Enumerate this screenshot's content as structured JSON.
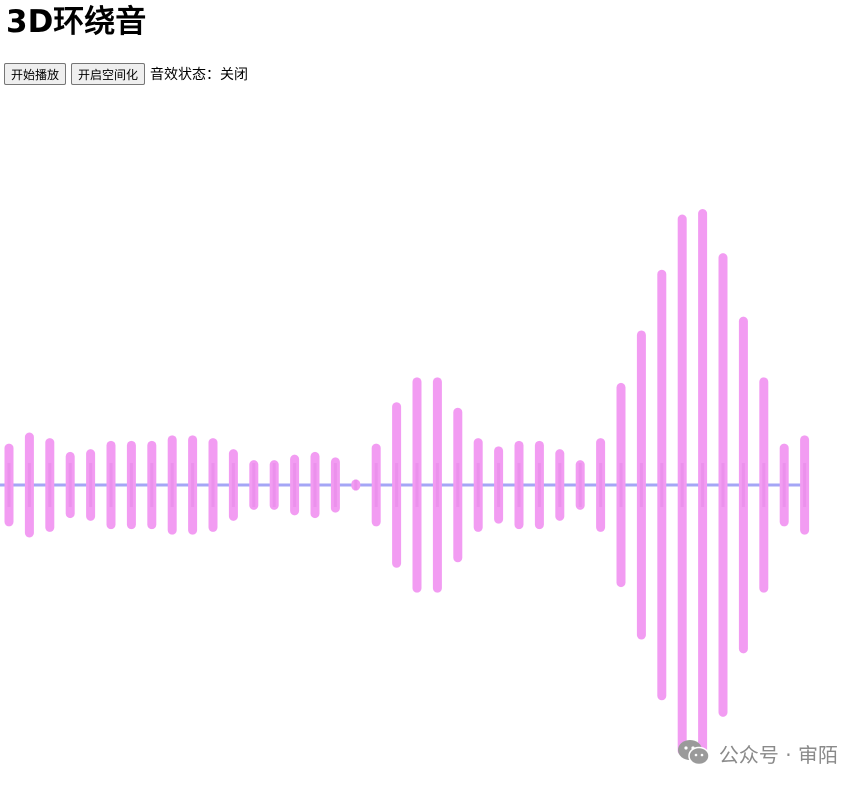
{
  "page": {
    "title": "3D环绕音"
  },
  "controls": {
    "play_label": "开始播放",
    "spatial_label": "开启空间化",
    "status_text": "音效状态：关闭"
  },
  "visualizer": {
    "bar_color": "#f29cf2",
    "midline_color": "#a4a6f6",
    "bar_levels": [
      0.15,
      0.19,
      0.17,
      0.12,
      0.13,
      0.16,
      0.16,
      0.16,
      0.18,
      0.18,
      0.17,
      0.13,
      0.09,
      0.09,
      0.11,
      0.12,
      0.1,
      0.02,
      0.15,
      0.3,
      0.39,
      0.39,
      0.28,
      0.17,
      0.14,
      0.16,
      0.16,
      0.13,
      0.09,
      0.17,
      0.37,
      0.56,
      0.78,
      0.98,
      1.0,
      0.84,
      0.61,
      0.39,
      0.15,
      0.18
    ]
  },
  "watermark": {
    "text": "公众号 · 审陌"
  }
}
